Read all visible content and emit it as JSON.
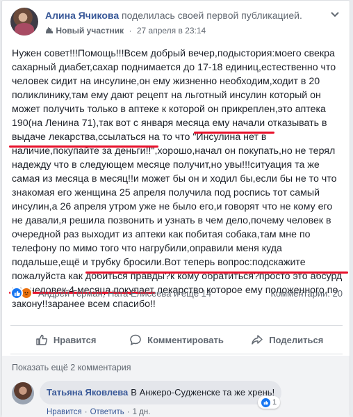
{
  "post": {
    "author_name": "Алина Ячикова",
    "author_action": "поделилась своей первой публикацией.",
    "badge": "Новый участник",
    "timestamp": "27 апреля в 23:14",
    "body": "Нужен совет!!!Помощь!!!Всем добрый вечер,подыстория:моего свекра сахарный диабет,сахар поднимается до 17-18 единиц,естественно что человек сидит на инсулине,он ему жизненно необходим,ходит в 20 поликлинику,там ему дают рецепт на льготный инсулин который он может получить только в аптеке к которой он прикреплен,это аптека 190(на Ленина 71),так вот с января месяца ему начали отказывать в выдаче лекарства,ссылаться на то что \"Инсулина нет в наличие,покупайте за деньги!!\",хорошо,начал он покупать,но не терял надежду что в следующем месяце получит,но увы!!!ситуация та же самая из месяца в месяц!!и может бы он и ходил бы,если бы не то что знакомая его женщина 25 апреля получила под роспись тот самый инсулин,а 26 апреля утром уже не было его,и говорят что не кому его не давали,я решила позвонить и узнать в чем дело,почему человек в очередной раз выходит из аптеки как побитая собака,там мне по телефону по мимо того что нагрубили,оправили меня куда подальше,ещё и трубку бросили.Вот теперь вопрос:подскажите пожалуйста как добиться правды?к кому обратиться?просто это абсурд что человек 4 месяца покупает лекарство которое ему положенного по закону!!заранее всем спасибо!!"
  },
  "stats": {
    "reactors": "Андрей Герман, Ната Елисеева и ещё 14",
    "comments_count": "Комментарии: 20"
  },
  "actions": {
    "like": "Нравится",
    "comment": "Комментировать",
    "share": "Поделиться"
  },
  "comments": {
    "more_link": "Показать ещё 2 комментария",
    "items": [
      {
        "author": "Татьяна Яковлева",
        "text": "В Анжеро-Судженске та же хрень!",
        "reaction_count": "1",
        "like_label": "Нравится",
        "reply_label": "Ответить",
        "time": "1 дн."
      }
    ]
  },
  "icons": {
    "header_menu": "chevron-down-icon",
    "badge": "new-member-icon",
    "like": "thumbs-up-icon",
    "comment": "comment-bubble-icon",
    "share": "share-arrow-icon"
  },
  "colors": {
    "link": "#385898",
    "highlight_underline": "#e8102a",
    "like_blue": "#1877f2"
  }
}
